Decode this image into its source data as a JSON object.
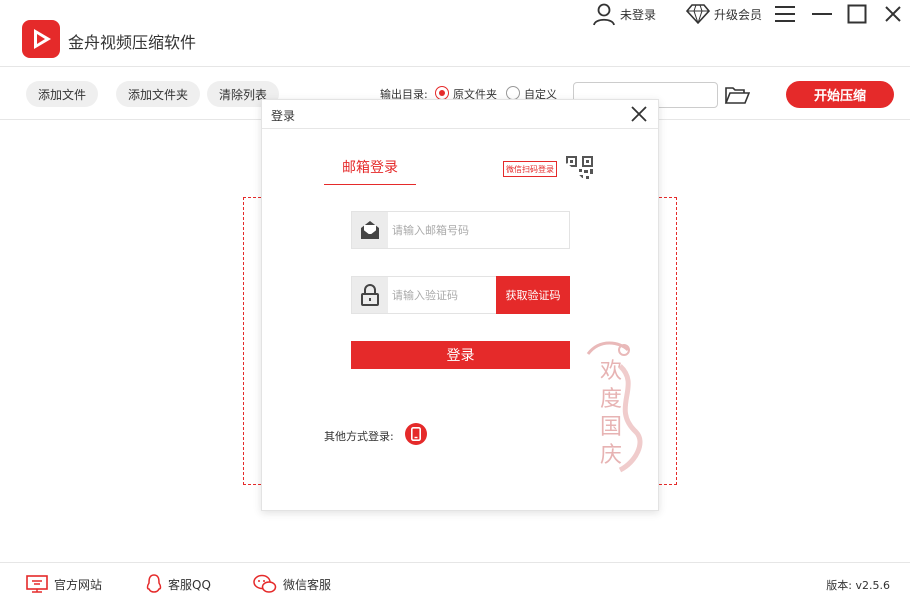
{
  "app": {
    "title": "金舟视频压缩软件"
  },
  "topbar": {
    "login_status": "未登录",
    "upgrade": "升级会员"
  },
  "toolbar": {
    "add_file": "添加文件",
    "add_folder": "添加文件夹",
    "clear_list": "清除列表",
    "output_label": "输出目录:",
    "option_source": "原文件夹",
    "option_custom": "自定义",
    "path_value": "",
    "start": "开始压缩"
  },
  "login_dialog": {
    "title": "登录",
    "tab_email": "邮箱登录",
    "qr_label": "微信扫码登录",
    "email_placeholder": "请输入邮箱号码",
    "code_placeholder": "请输入验证码",
    "get_code": "获取验证码",
    "submit": "登录",
    "other_methods": "其他方式登录:",
    "festive_text": "欢度国庆"
  },
  "footer": {
    "website": "官方网站",
    "qq": "客服QQ",
    "wechat": "微信客服",
    "version": "版本: v2.5.6"
  },
  "colors": {
    "accent": "#e52a2a"
  }
}
